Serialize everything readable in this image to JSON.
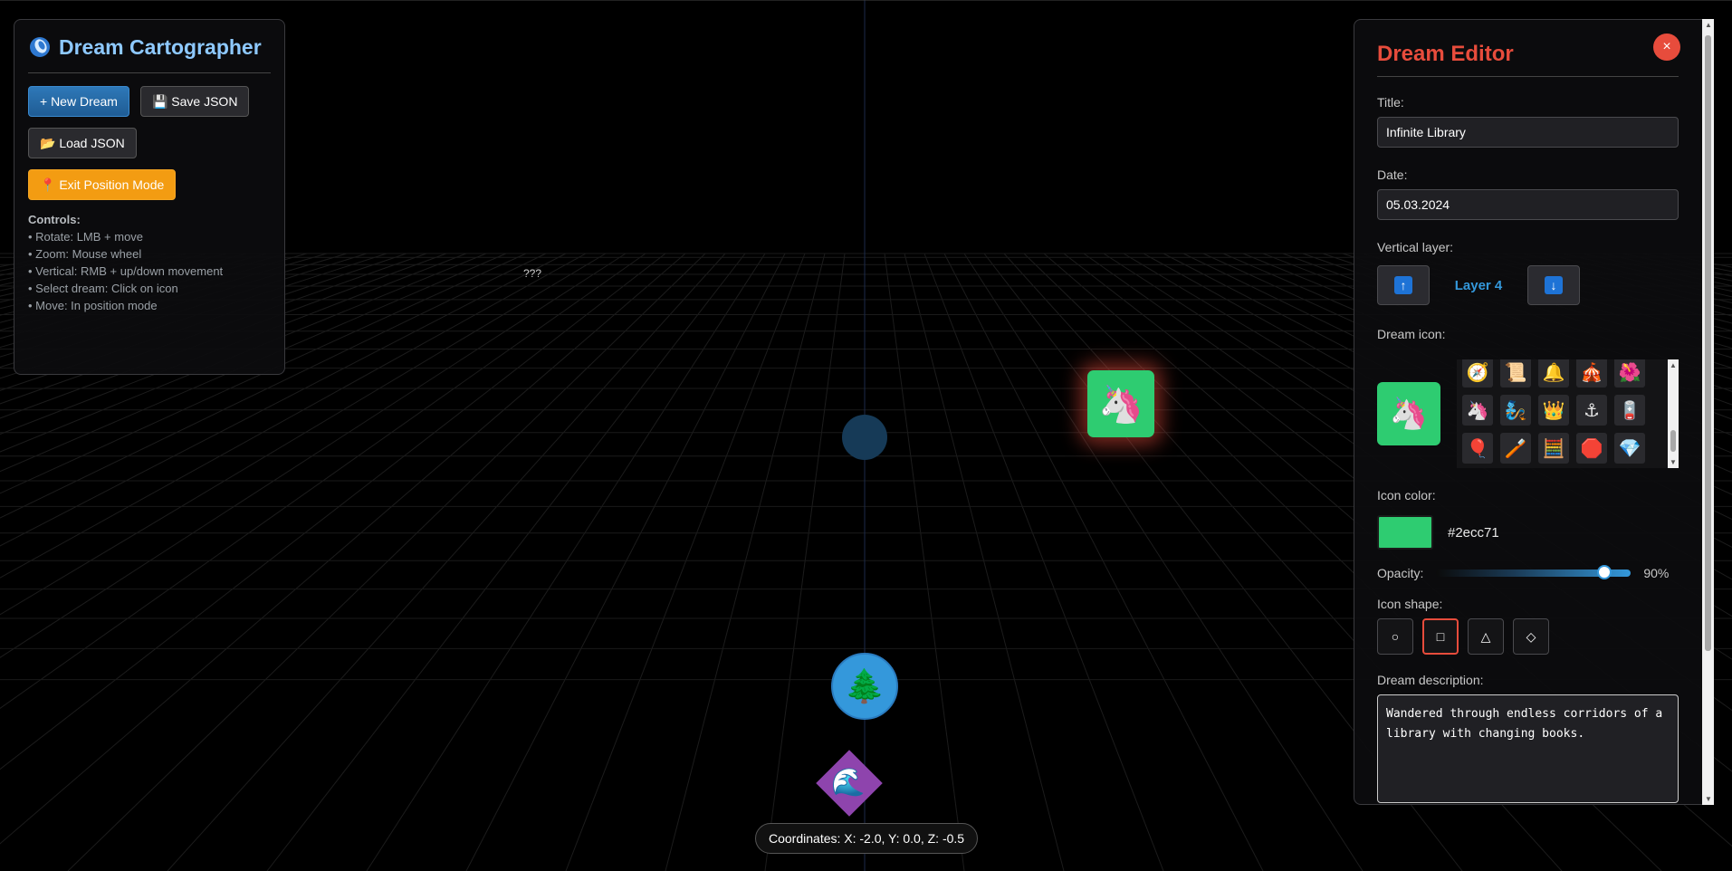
{
  "app": {
    "title": "Dream Cartographer",
    "buttons": {
      "new_dream": "+ New Dream",
      "save_json": "💾 Save JSON",
      "load_json": "📂 Load JSON",
      "exit_position": "📍 Exit Position Mode"
    },
    "controls": {
      "heading": "Controls:",
      "items": [
        "• Rotate: LMB + move",
        "• Zoom: Mouse wheel",
        "• Vertical: RMB + up/down movement",
        "• Select dream: Click on icon",
        "• Move: In position mode"
      ]
    }
  },
  "scene": {
    "question_marks": "???",
    "coordinates": "Coordinates: X: -2.0, Y: 0.0, Z: -0.5",
    "objects": {
      "unicorn": "🦄",
      "tree": "🌲",
      "wave": "🌊"
    }
  },
  "editor": {
    "title": "Dream Editor",
    "close_label": "×",
    "title_label": "Title:",
    "title_value": "Infinite Library",
    "date_label": "Date:",
    "date_value": "05.03.2024",
    "layer_label": "Vertical layer:",
    "layer_value": "Layer 4",
    "layer_up": "↑",
    "layer_down": "↓",
    "icon_label": "Dream icon:",
    "selected_icon": "🦄",
    "icon_grid": [
      "🧭",
      "📜",
      "🔔",
      "🎪",
      "🌺",
      "🦄",
      "🧞",
      "👑",
      "⚓",
      "🪫",
      "🎈",
      "🪥",
      "🧮",
      "🛑",
      "💎"
    ],
    "color_label": "Icon color:",
    "color_value": "#2ecc71",
    "opacity_label": "Opacity:",
    "opacity_value": "90%",
    "opacity_fraction": 0.9,
    "shape_label": "Icon shape:",
    "shapes": [
      "○",
      "□",
      "△",
      "◇"
    ],
    "active_shape_index": 1,
    "description_label": "Dream description:",
    "description_value": "Wandered through endless corridors of a library with changing books."
  }
}
